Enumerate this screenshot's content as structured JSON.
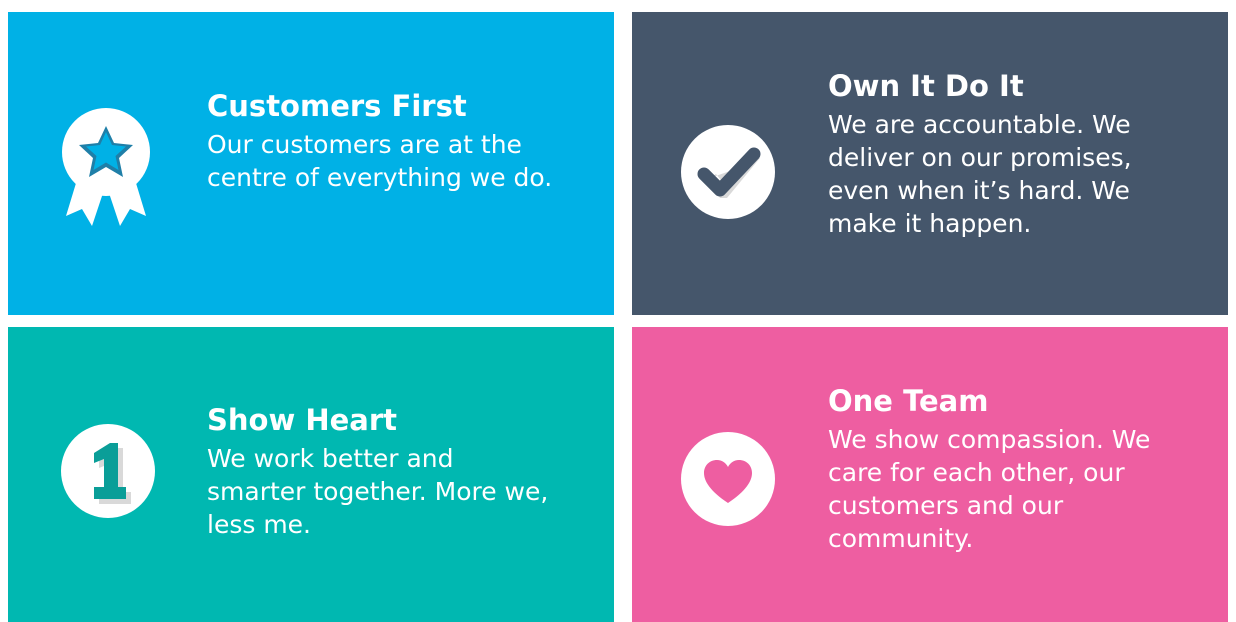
{
  "values": [
    {
      "title": "Customers First",
      "description": "Our customers are at the centre of everything we do.",
      "icon": "award-ribbon-star-icon",
      "color": "#00b1e6"
    },
    {
      "title": "Own It Do It",
      "description": "We are accountable. We deliver on our promises, even when it’s hard. We make it happen.",
      "icon": "check-circle-icon",
      "color": "#45566b"
    },
    {
      "title": "Show Heart",
      "description": "We work better and smarter together. More we, less me.",
      "icon": "number-one-circle-icon",
      "color": "#00b8b1"
    },
    {
      "title": "One Team",
      "description": "We show compassion. We care for each other, our customers and our community.",
      "icon": "heart-circle-icon",
      "color": "#ee5ea1"
    }
  ]
}
